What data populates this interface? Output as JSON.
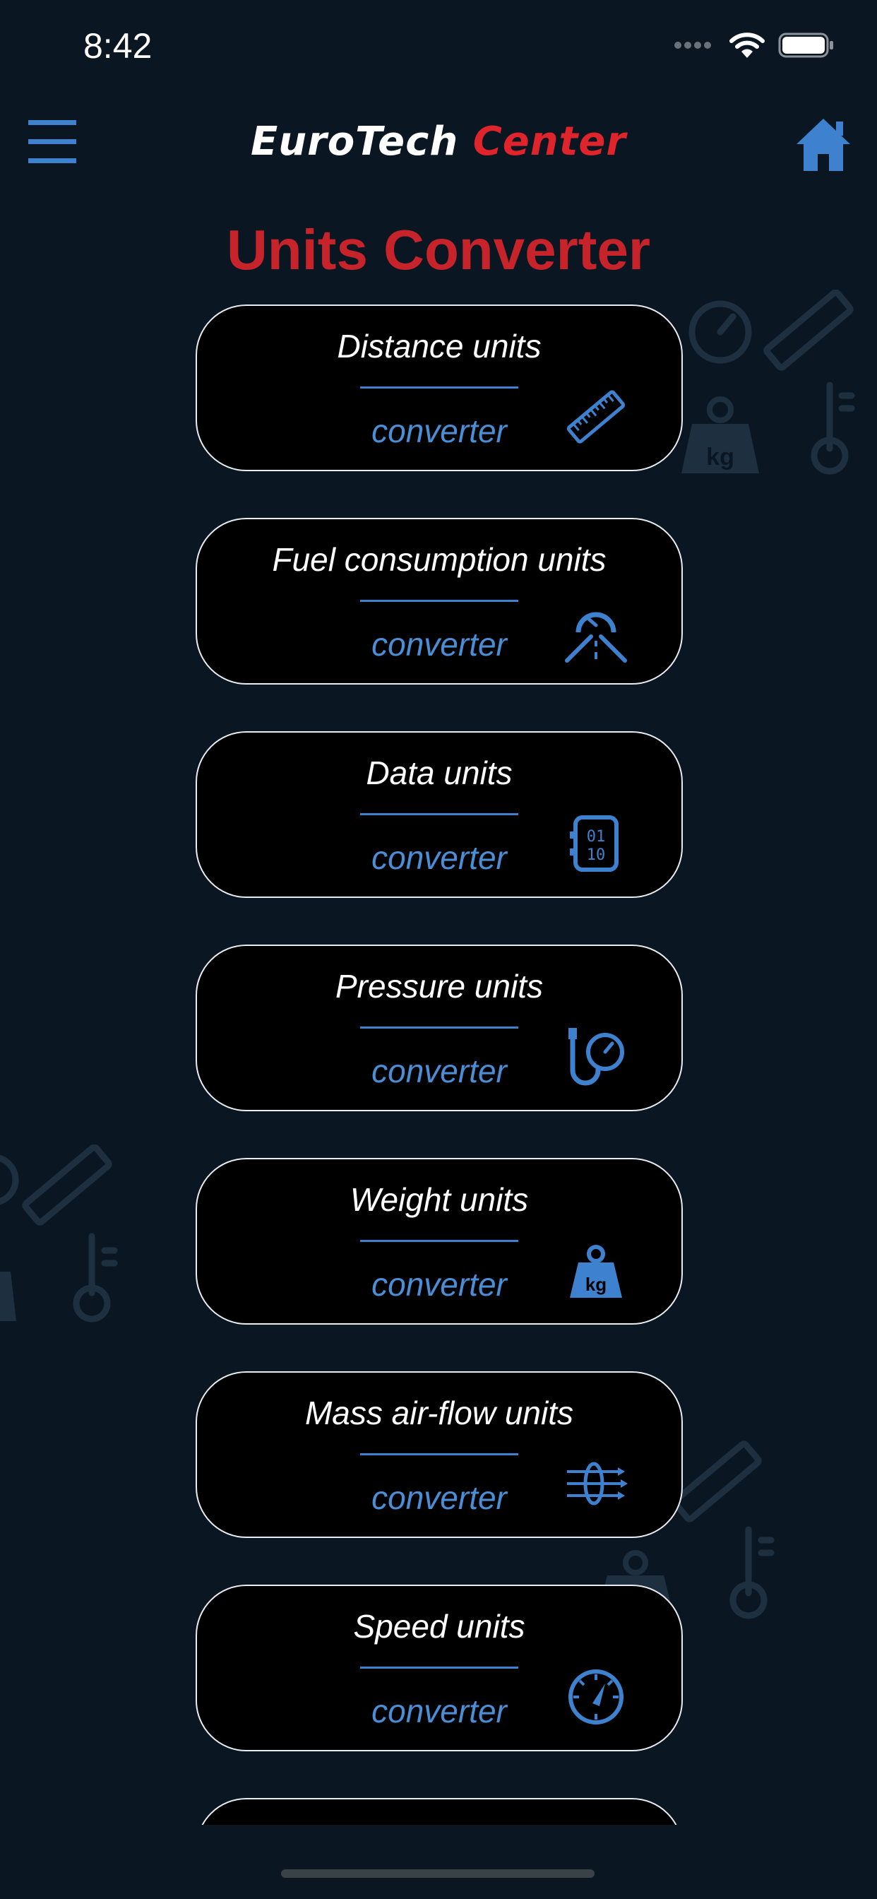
{
  "status": {
    "time": "8:42"
  },
  "header": {
    "logo_part1": "EuroTech",
    "logo_part2": "Center",
    "menu_icon": "hamburger-menu-icon",
    "home_icon": "home-icon"
  },
  "page": {
    "title": "Units Converter"
  },
  "converters": [
    {
      "title": "Distance units",
      "subtitle": "converter",
      "icon": "ruler-icon"
    },
    {
      "title": "Fuel consumption units",
      "subtitle": "converter",
      "icon": "road-gauge-icon"
    },
    {
      "title": "Data units",
      "subtitle": "converter",
      "icon": "binary-data-icon"
    },
    {
      "title": "Pressure units",
      "subtitle": "converter",
      "icon": "pressure-gauge-icon"
    },
    {
      "title": "Weight units",
      "subtitle": "converter",
      "icon": "weight-kg-icon"
    },
    {
      "title": "Mass air-flow units",
      "subtitle": "converter",
      "icon": "airflow-icon"
    },
    {
      "title": "Speed units",
      "subtitle": "converter",
      "icon": "speedometer-icon"
    }
  ],
  "colors": {
    "background": "#0a1722",
    "accent_blue": "#3e82cf",
    "title_red": "#c7232b",
    "card_border": "#e9edf2"
  }
}
